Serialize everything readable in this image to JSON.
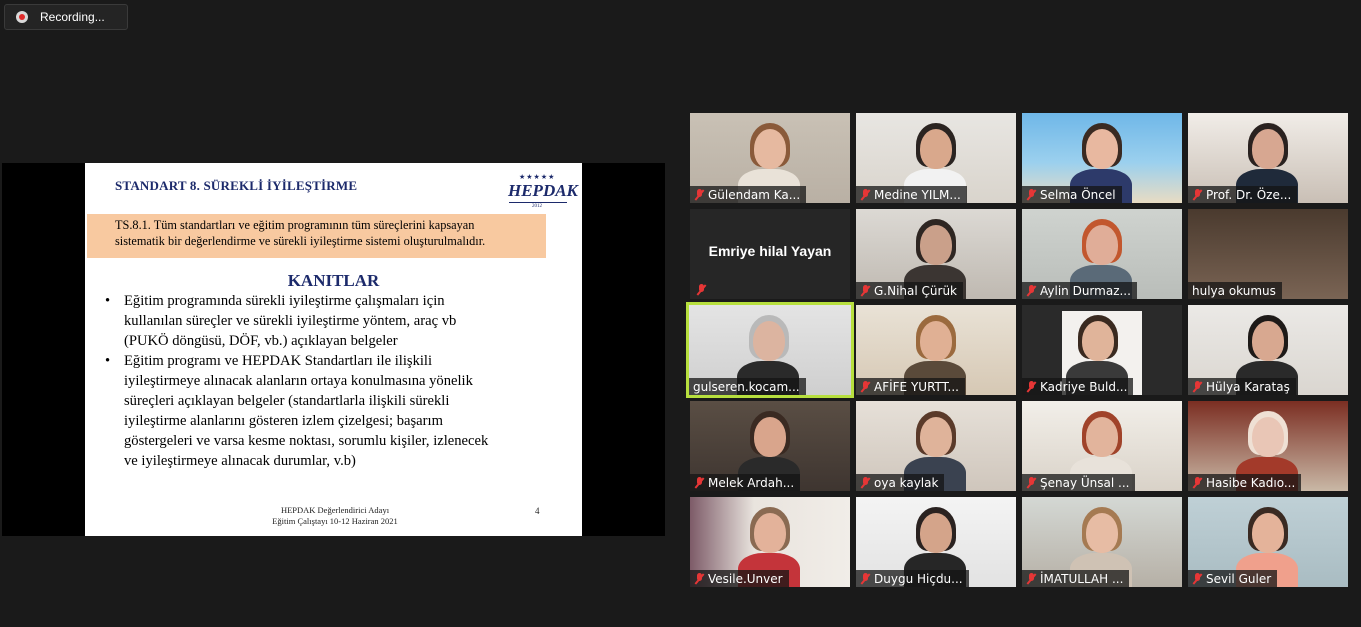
{
  "recording": {
    "label": "Recording..."
  },
  "slide": {
    "title": "STANDART 8. SÜREKLİ İYİLEŞTİRME",
    "logo_text": "HEPDAK",
    "logo_stars": "★★★★★",
    "logo_year": "2012",
    "standard_lines": [
      "TS.8.1. Tüm standartları ve eğitim programının tüm süreçlerini kapsayan",
      "sistematik bir değerlendirme ve sürekli iyileştirme sistemi oluşturulmalıdır."
    ],
    "evidence_heading": "KANITLAR",
    "bullet1": [
      "Eğitim programında sürekli iyileştirme çalışmaları için",
      "kullanılan süreçler ve sürekli iyileştirme yöntem, araç vb",
      "(PUKÖ döngüsü, DÖF, vb.) açıklayan belgeler"
    ],
    "bullet2": [
      "Eğitim programı ve HEPDAK Standartları ile ilişkili",
      "iyileştirmeye alınacak alanların ortaya konulmasına yönelik",
      "süreçleri açıklayan belgeler (standartlarla ilişkili sürekli",
      "iyileştirme alanlarını gösteren izlem çizelgesi; başarım",
      "göstergeleri ve varsa kesme noktası, sorumlu kişiler, izlenecek",
      "ve iyileştirmeye alınacak durumlar, v.b)"
    ],
    "footer_line1": "HEPDAK Değerlendirici Adayı",
    "footer_line2": "Eğitim Çalıştayı 10-12 Haziran 2021",
    "page_number": "4"
  },
  "participants": [
    {
      "name": "Gülendam Ka...",
      "muted": true
    },
    {
      "name": "Medine YILM...",
      "muted": true
    },
    {
      "name": "Selma Öncel",
      "muted": true
    },
    {
      "name": "Prof. Dr. Öze...",
      "muted": true
    },
    {
      "name": "Emriye hilal Yayan",
      "muted": true
    },
    {
      "name": "G.Nihal Çürük",
      "muted": true
    },
    {
      "name": "Aylin Durmaz...",
      "muted": true
    },
    {
      "name": "hulya okumus",
      "muted": false
    },
    {
      "name": "gulseren.kocam...",
      "muted": false
    },
    {
      "name": "AFİFE YURTT...",
      "muted": true
    },
    {
      "name": "Kadriye Buld...",
      "muted": true
    },
    {
      "name": "Hülya Karataş",
      "muted": true
    },
    {
      "name": "Melek Ardah...",
      "muted": true
    },
    {
      "name": "oya kaylak",
      "muted": true
    },
    {
      "name": "Şenay Ünsal ...",
      "muted": true
    },
    {
      "name": "Hasibe Kadıo...",
      "muted": true
    },
    {
      "name": "Vesile.Unver",
      "muted": true
    },
    {
      "name": "Duygu Hiçdu...",
      "muted": true
    },
    {
      "name": "İMATULLAH ...",
      "muted": true
    },
    {
      "name": "Sevil Guler",
      "muted": true
    }
  ],
  "icons": {
    "recording": "record-icon",
    "muted": "mic-muted-icon"
  },
  "colors": {
    "active_speaker": "#b7df3e",
    "muted_mic": "#e63636",
    "slide_title": "#1c2a6b",
    "highlight_box": "#f8c9a0"
  }
}
